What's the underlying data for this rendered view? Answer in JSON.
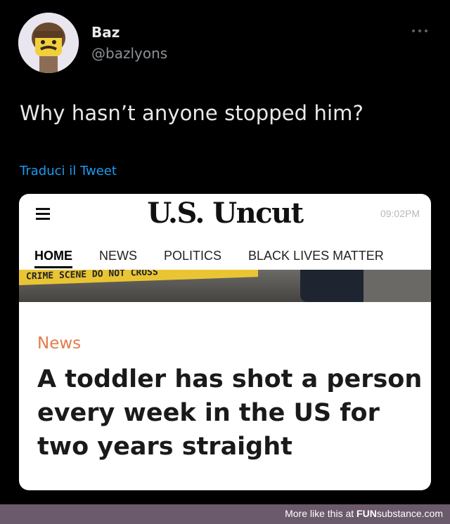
{
  "tweet": {
    "display_name": "Baz",
    "handle": "@bazlyons",
    "text": "Why hasn’t anyone stopped him?",
    "translate_label": "Traduci il Tweet",
    "more_icon": "more-horizontal-icon"
  },
  "card": {
    "masthead": "U.S. Uncut",
    "time": "09:02PM",
    "nav": [
      "HOME",
      "NEWS",
      "POLITICS",
      "BLACK LIVES MATTER"
    ],
    "tape_text": "CRIME SCENE DO NOT CROSS",
    "section_label": "News",
    "headline": "A toddler has shot a person every week in the US for two years straight"
  },
  "footer": {
    "prefix": "More like this at ",
    "brand_bold": "FUN",
    "brand_rest": "substance",
    "suffix": ".com"
  },
  "colors": {
    "background": "#000000",
    "link": "#1d9bf0",
    "section": "#e57a4a",
    "footer_bg": "#6b5a6b"
  }
}
